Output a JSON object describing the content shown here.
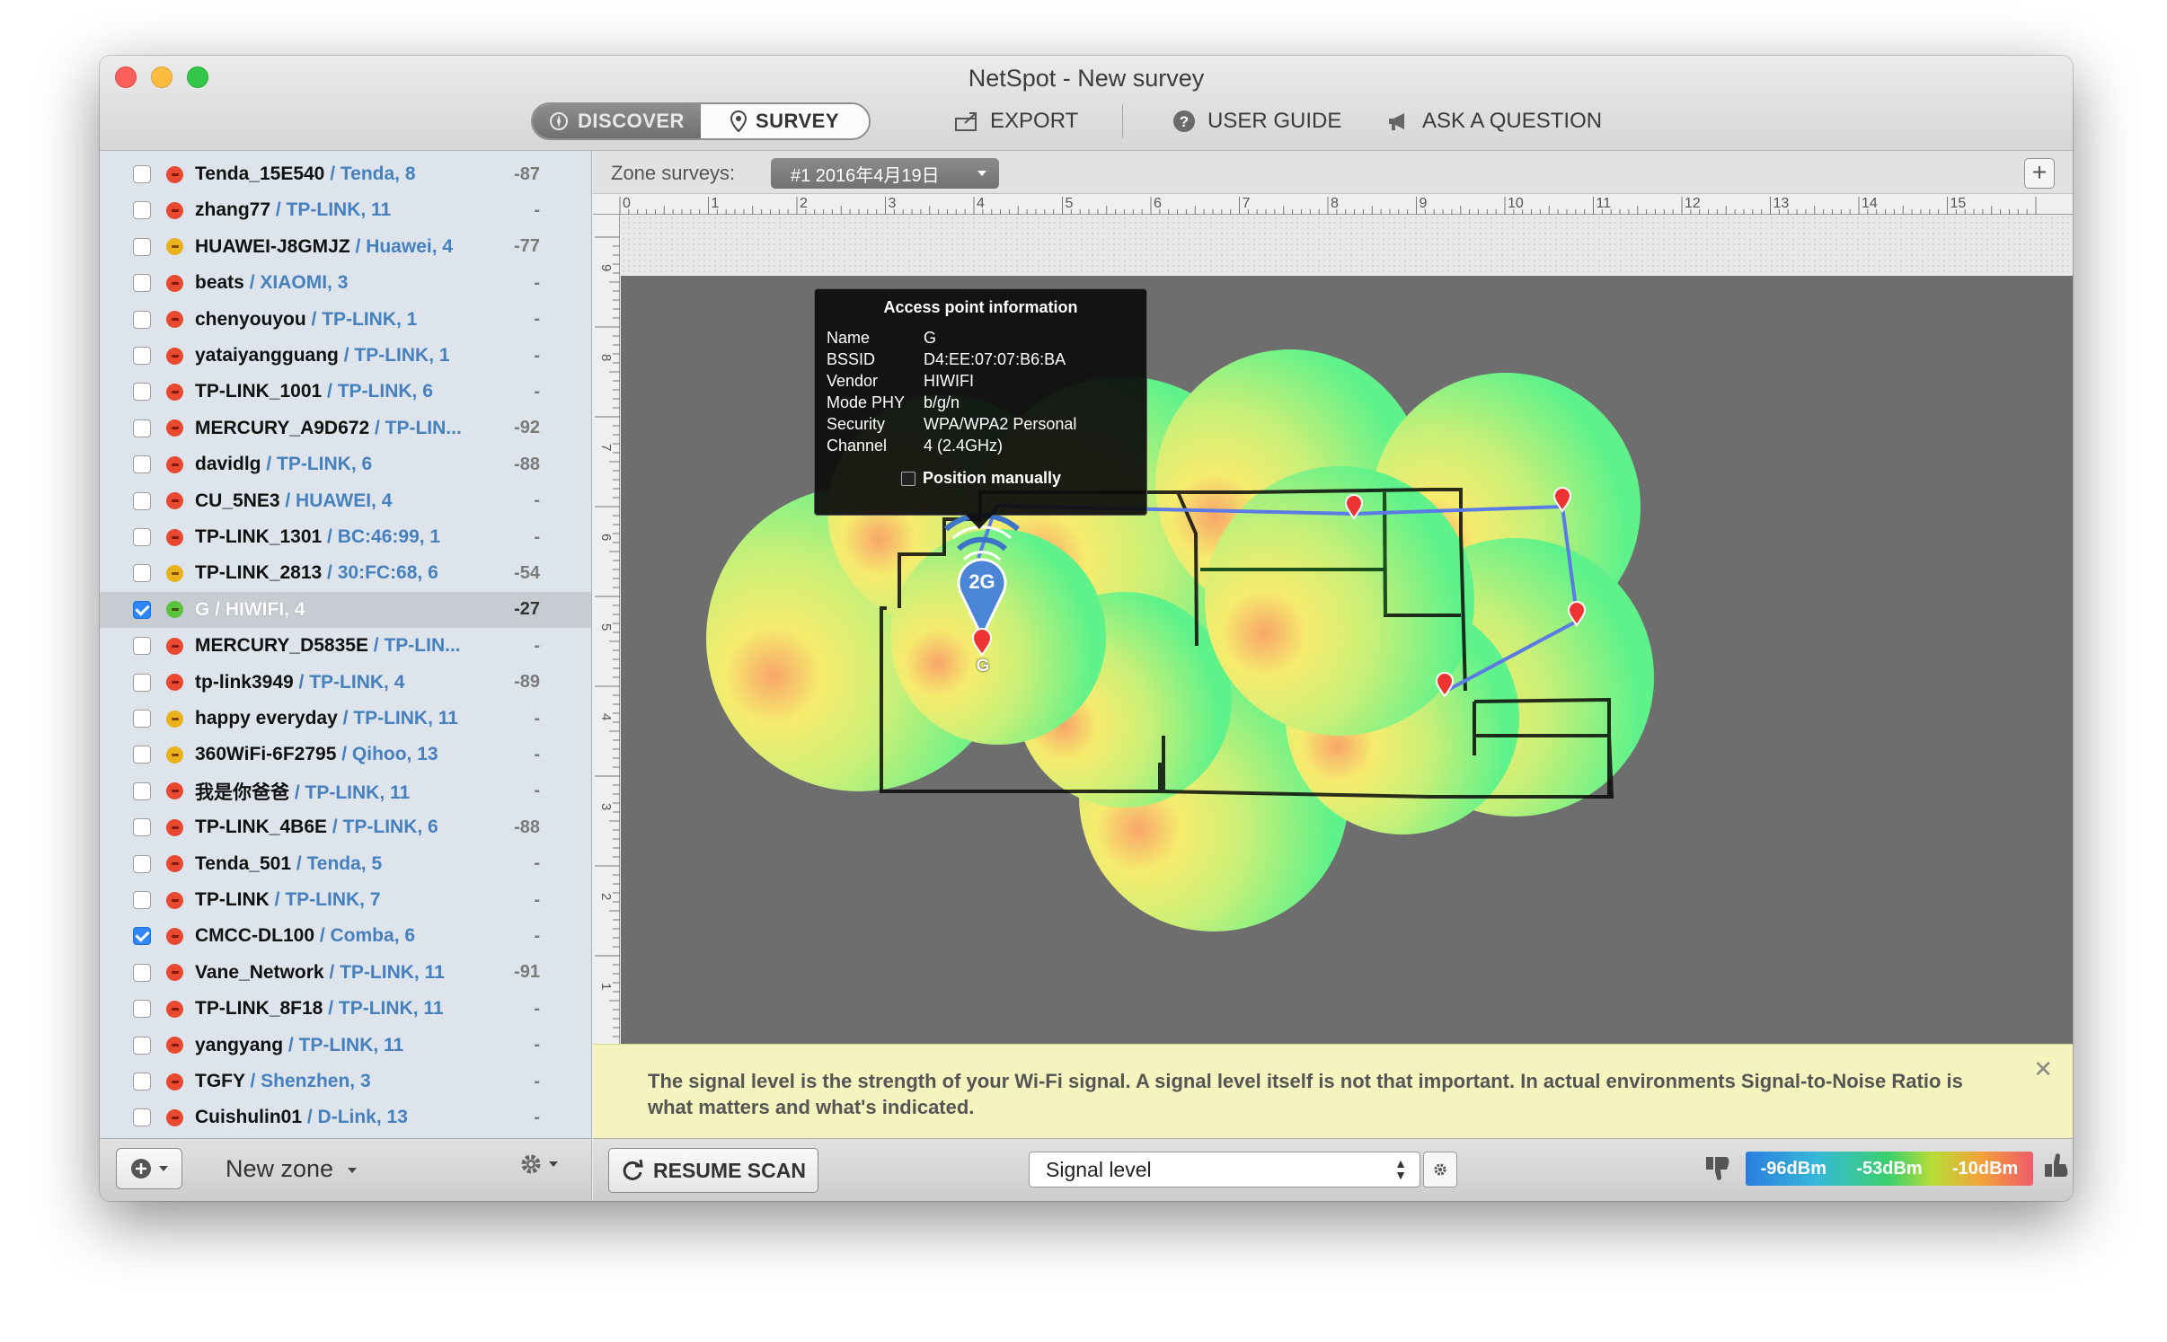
{
  "window": {
    "title": "NetSpot - New survey"
  },
  "toolbar": {
    "discover_label": "DISCOVER",
    "survey_label": "SURVEY",
    "export_label": "EXPORT",
    "user_guide_label": "USER GUIDE",
    "ask_label": "ASK A QUESTION"
  },
  "sidebar": {
    "networks": [
      {
        "name": "Tenda_15E540",
        "vendor": " / Tenda, 8",
        "signal": "-87",
        "checked": false,
        "security": "red"
      },
      {
        "name": "zhang77",
        "vendor": " / TP-LINK, 11",
        "signal": "-",
        "checked": false,
        "security": "red"
      },
      {
        "name": "HUAWEI-J8GMJZ",
        "vendor": " / Huawei, 4",
        "signal": "-77",
        "checked": false,
        "security": "yellow"
      },
      {
        "name": "beats",
        "vendor": " / XIAOMI, 3",
        "signal": "-",
        "checked": false,
        "security": "red"
      },
      {
        "name": "chenyouyou",
        "vendor": " / TP-LINK, 1",
        "signal": "-",
        "checked": false,
        "security": "red"
      },
      {
        "name": "yataiyangguang",
        "vendor": " / TP-LINK, 1",
        "signal": "-",
        "checked": false,
        "security": "red"
      },
      {
        "name": "TP-LINK_1001",
        "vendor": " / TP-LINK, 6",
        "signal": "-",
        "checked": false,
        "security": "red"
      },
      {
        "name": "MERCURY_A9D672",
        "vendor": " / TP-LIN...",
        "signal": "-92",
        "checked": false,
        "security": "red"
      },
      {
        "name": "davidlg",
        "vendor": " / TP-LINK, 6",
        "signal": "-88",
        "checked": false,
        "security": "red"
      },
      {
        "name": "CU_5NE3",
        "vendor": " / HUAWEI, 4",
        "signal": "-",
        "checked": false,
        "security": "red"
      },
      {
        "name": "TP-LINK_1301",
        "vendor": " / BC:46:99, 1",
        "signal": "-",
        "checked": false,
        "security": "red"
      },
      {
        "name": "TP-LINK_2813",
        "vendor": " / 30:FC:68, 6",
        "signal": "-54",
        "checked": false,
        "security": "yellow"
      },
      {
        "name": "G",
        "vendor": " / HIWIFI, 4",
        "signal": "-27",
        "checked": true,
        "security": "green",
        "selected": true
      },
      {
        "name": "MERCURY_D5835E",
        "vendor": " / TP-LIN...",
        "signal": "-",
        "checked": false,
        "security": "red"
      },
      {
        "name": "tp-link3949",
        "vendor": " / TP-LINK, 4",
        "signal": "-89",
        "checked": false,
        "security": "red"
      },
      {
        "name": "happy everyday",
        "vendor": " / TP-LINK, 11",
        "signal": "-",
        "checked": false,
        "security": "yellow"
      },
      {
        "name": "360WiFi-6F2795",
        "vendor": " / Qihoo, 13",
        "signal": "-",
        "checked": false,
        "security": "yellow"
      },
      {
        "name": "我是你爸爸",
        "vendor": " / TP-LINK, 11",
        "signal": "-",
        "checked": false,
        "security": "red"
      },
      {
        "name": "TP-LINK_4B6E",
        "vendor": " / TP-LINK, 6",
        "signal": "-88",
        "checked": false,
        "security": "red"
      },
      {
        "name": "Tenda_501",
        "vendor": " / Tenda, 5",
        "signal": "-",
        "checked": false,
        "security": "red"
      },
      {
        "name": "TP-LINK",
        "vendor": " / TP-LINK, 7",
        "signal": "-",
        "checked": false,
        "security": "red"
      },
      {
        "name": "CMCC-DL100",
        "vendor": " / Comba, 6",
        "signal": "-",
        "checked": true,
        "security": "red"
      },
      {
        "name": "Vane_Network",
        "vendor": " / TP-LINK, 11",
        "signal": "-91",
        "checked": false,
        "security": "red"
      },
      {
        "name": "TP-LINK_8F18",
        "vendor": " / TP-LINK, 11",
        "signal": "-",
        "checked": false,
        "security": "red"
      },
      {
        "name": "yangyang",
        "vendor": " / TP-LINK, 11",
        "signal": "-",
        "checked": false,
        "security": "red"
      },
      {
        "name": "TGFY",
        "vendor": " / Shenzhen, 3",
        "signal": "-",
        "checked": false,
        "security": "red"
      },
      {
        "name": "Cuishulin01",
        "vendor": " / D-Link, 13",
        "signal": "-",
        "checked": false,
        "security": "red"
      }
    ],
    "new_zone_label": "New zone"
  },
  "zone": {
    "label": "Zone surveys:",
    "selected": "#1 2016年4月19日"
  },
  "ruler": {
    "top_ticks": [
      "0",
      "1",
      "2",
      "3",
      "4",
      "5",
      "6",
      "7",
      "8",
      "9",
      "10",
      "11",
      "12",
      "13",
      "14",
      "15"
    ],
    "left_ticks": [
      "9",
      "8",
      "7",
      "6",
      "5",
      "4",
      "3",
      "2",
      "1"
    ]
  },
  "access_point_info": {
    "title": "Access point information",
    "rows": [
      {
        "key": "Name",
        "value": "G"
      },
      {
        "key": "BSSID",
        "value": "D4:EE:07:07:B6:BA"
      },
      {
        "key": "Vendor",
        "value": "HIWIFI"
      },
      {
        "key": "Mode PHY",
        "value": "b/g/n"
      },
      {
        "key": "Security",
        "value": "WPA/WPA2 Personal"
      },
      {
        "key": "Channel",
        "value": "4 (2.4GHz)"
      }
    ],
    "position_manually_label": "Position manually",
    "band_label": "2G",
    "ap_name": "G"
  },
  "info_banner": {
    "text": "The signal level is the strength of your Wi-Fi signal. A signal level itself is not that important. In actual environments Signal-to-Noise Ratio is what matters and what's indicated."
  },
  "bottom": {
    "resume_label": "RESUME SCAN",
    "visualization": "Signal level",
    "legend": [
      "-96dBm",
      "-53dBm",
      "-10dBm"
    ]
  },
  "colors": {
    "secure_red": "#e8482f",
    "secure_yellow": "#e9b21a",
    "secure_green": "#5cc43c",
    "vendor_blue": "#4680bd",
    "selection_blue": "#2f86f6"
  }
}
